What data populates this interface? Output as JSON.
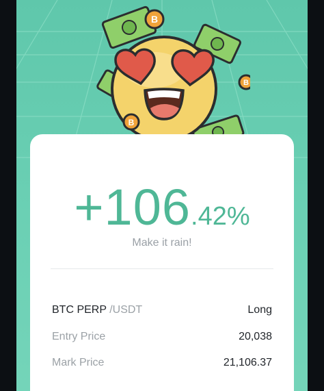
{
  "pnl": {
    "sign_int": "+106",
    "decimal_pct": ".42%",
    "tagline": "Make it rain!"
  },
  "position": {
    "pair": "BTC PERP",
    "quote": "/USDT",
    "side": "Long"
  },
  "prices": [
    {
      "label": "Entry Price",
      "value": "20,038"
    },
    {
      "label": "Mark Price",
      "value": "21,106.37"
    }
  ],
  "coin_symbol": "B",
  "colors": {
    "background_top": "#5fc7ab",
    "accent_green": "#4fb796",
    "card": "#ffffff"
  }
}
